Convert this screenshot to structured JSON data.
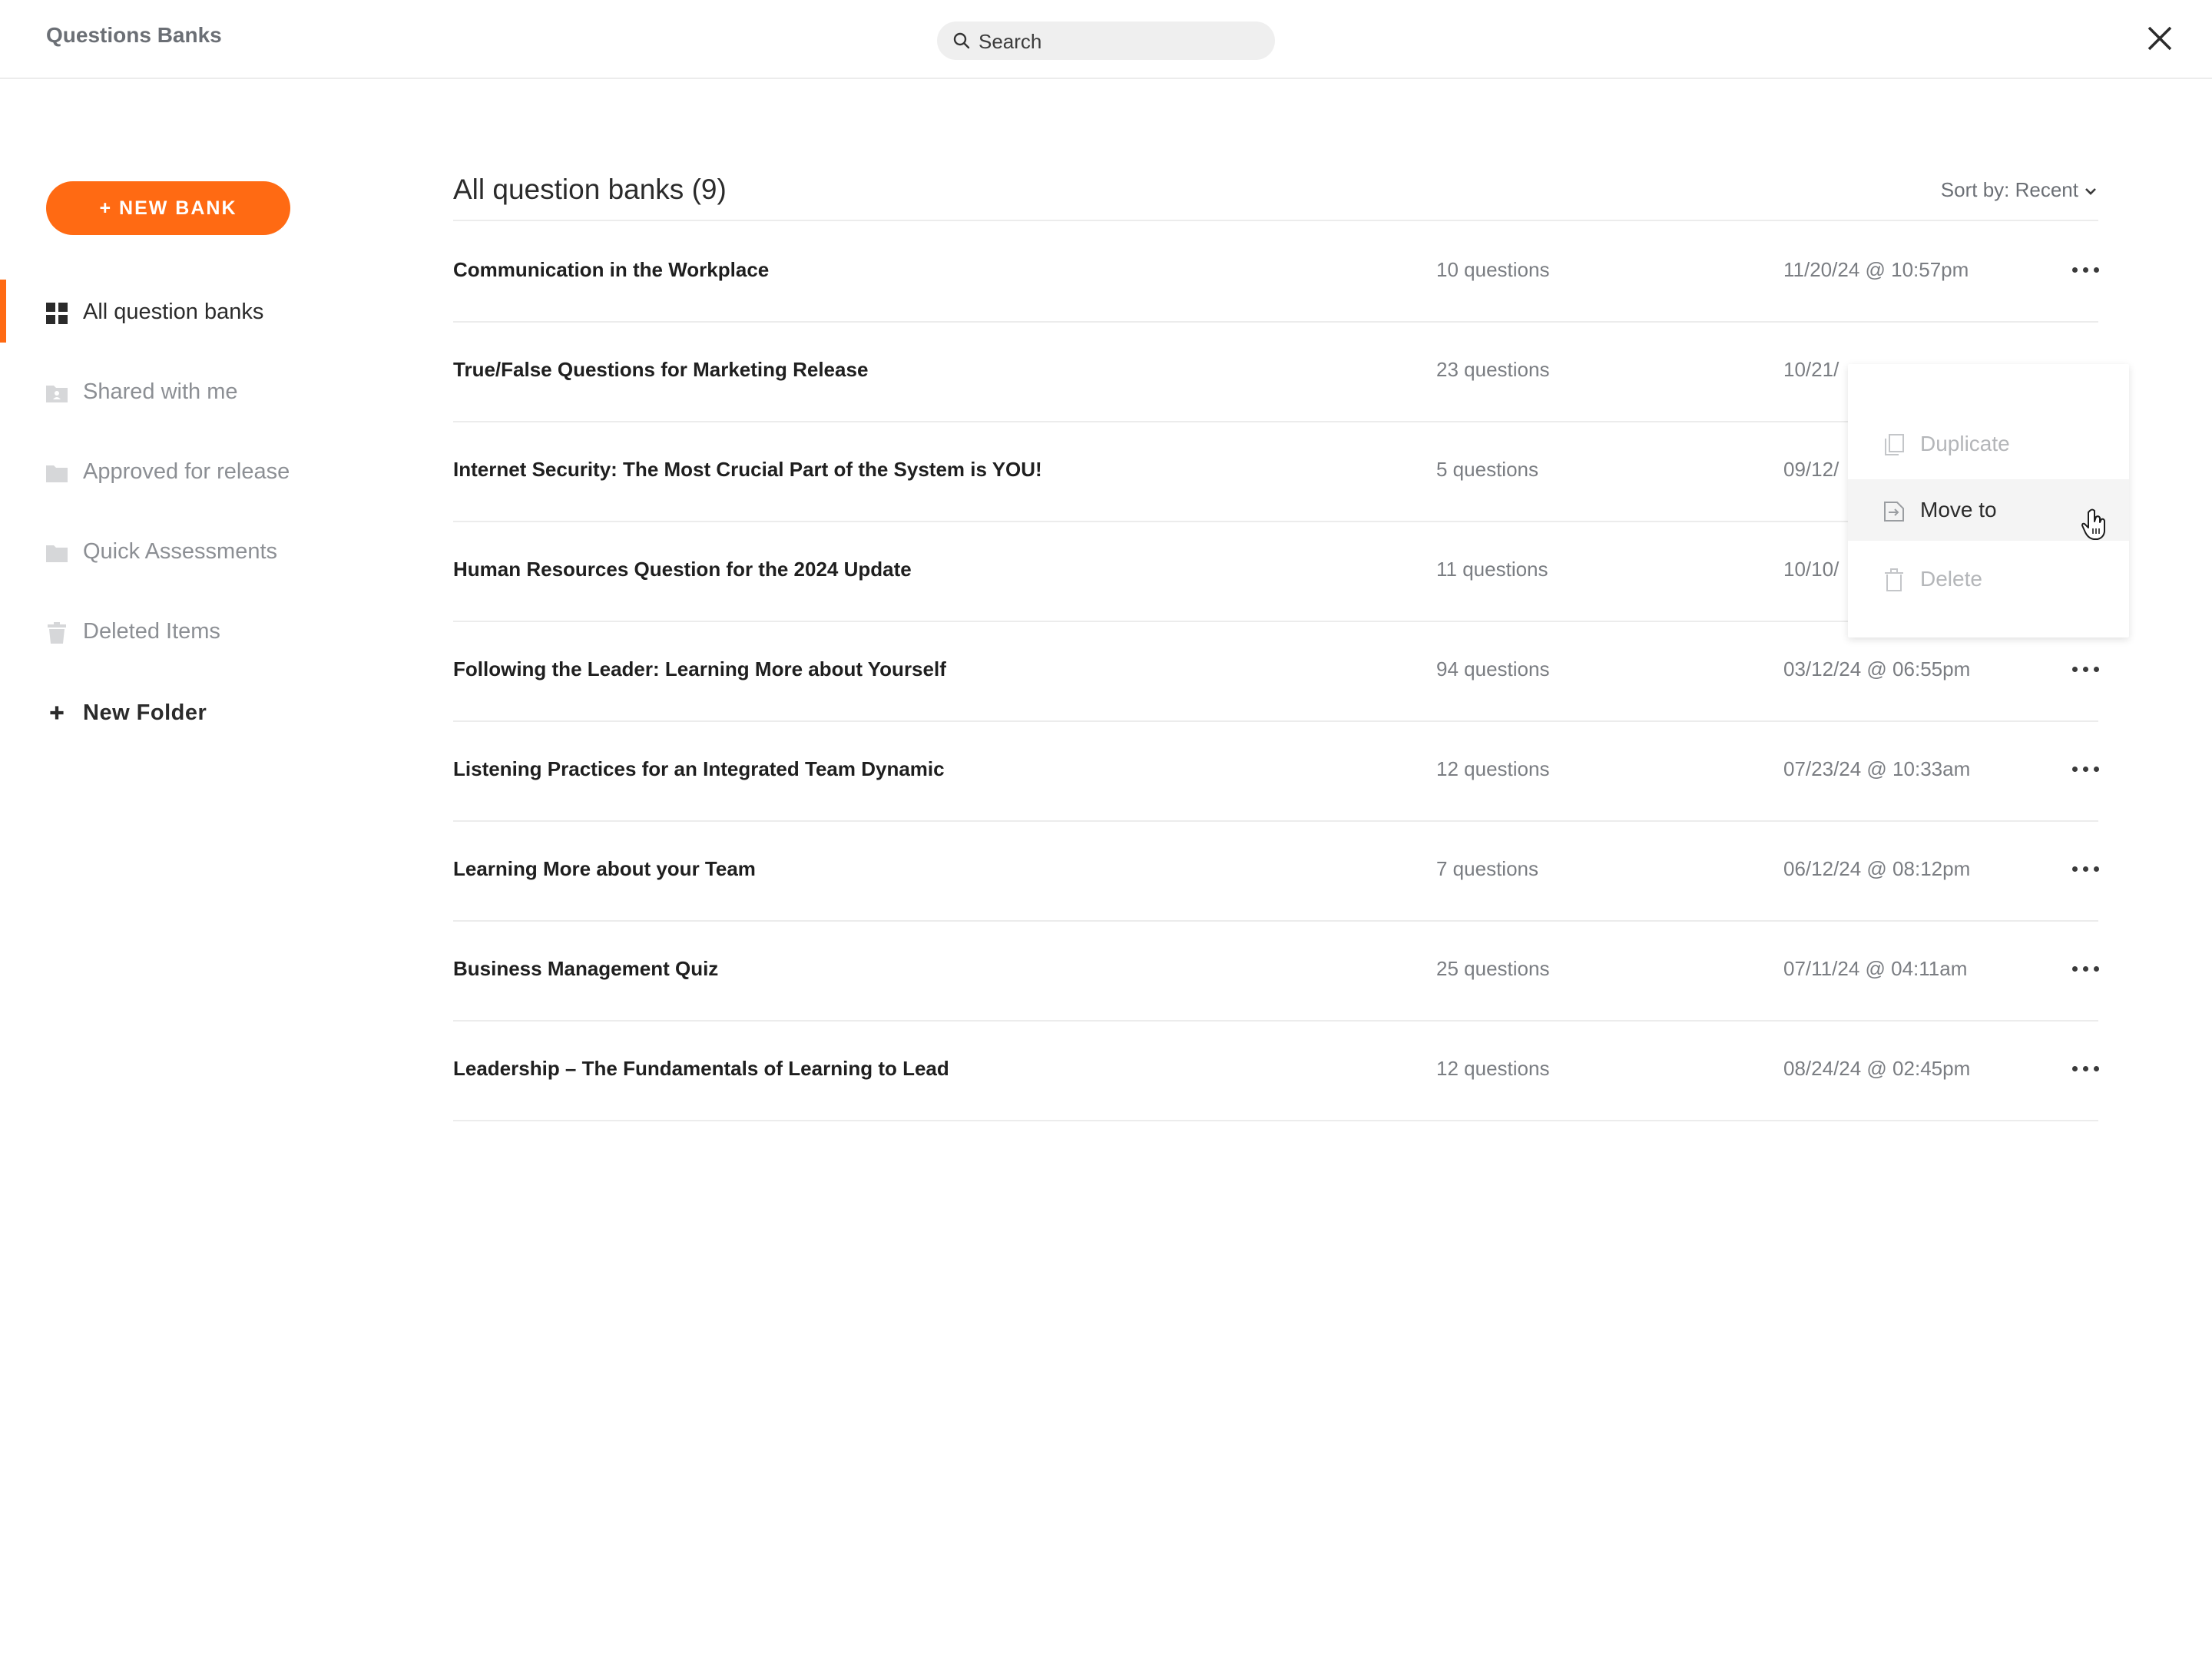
{
  "header": {
    "title": "Questions Banks",
    "search_placeholder": "Search"
  },
  "sidebar": {
    "new_bank_label": "+ NEW BANK",
    "items": [
      {
        "label": "All question banks",
        "icon": "grid-icon",
        "active": true
      },
      {
        "label": "Shared with me",
        "icon": "shared-folder-icon"
      },
      {
        "label": "Approved for release",
        "icon": "folder-icon"
      },
      {
        "label": "Quick Assessments",
        "icon": "folder-icon"
      },
      {
        "label": "Deleted Items",
        "icon": "trash-icon"
      }
    ],
    "new_folder_label": "New Folder"
  },
  "main": {
    "title": "All question banks (9)",
    "sort_label": "Sort by: Recent",
    "rows": [
      {
        "name": "Communication in the Workplace",
        "count": "10 questions",
        "date": "11/20/24 @ 10:57pm"
      },
      {
        "name": "True/False Questions for Marketing Release",
        "count": "23 questions",
        "date": "10/21/"
      },
      {
        "name": "Internet Security: The Most Crucial Part of the System is YOU!",
        "count": "5 questions",
        "date": "09/12/"
      },
      {
        "name": "Human Resources Question for the 2024 Update",
        "count": "11 questions",
        "date": "10/10/"
      },
      {
        "name": "Following the Leader: Learning More about Yourself",
        "count": "94 questions",
        "date": "03/12/24 @ 06:55pm"
      },
      {
        "name": "Listening Practices for an Integrated Team Dynamic",
        "count": "12 questions",
        "date": "07/23/24 @ 10:33am"
      },
      {
        "name": "Learning More about your Team",
        "count": "7 questions",
        "date": "06/12/24 @ 08:12pm"
      },
      {
        "name": "Business Management Quiz",
        "count": "25 questions",
        "date": "07/11/24 @ 04:11am"
      },
      {
        "name": "Leadership – The Fundamentals of Learning to Lead",
        "count": "12 questions",
        "date": "08/24/24 @ 02:45pm"
      }
    ]
  },
  "context_menu": {
    "items": [
      {
        "label": "Duplicate",
        "icon": "duplicate-icon"
      },
      {
        "label": "Move to",
        "icon": "move-to-icon"
      },
      {
        "label": "Delete",
        "icon": "trash-icon"
      }
    ]
  },
  "colors": {
    "accent": "#ff6a13",
    "divider": "#ececec"
  }
}
